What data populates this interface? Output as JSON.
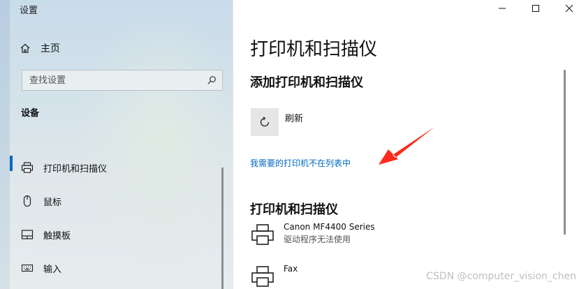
{
  "window": {
    "title": "设置",
    "controls": {
      "minimize": "—",
      "maximize": "☐",
      "close": "✕"
    }
  },
  "sidebar": {
    "home_label": "主页",
    "search": {
      "placeholder": "查找设置"
    },
    "section_heading": "设备",
    "items": [
      {
        "label": "打印机和扫描仪",
        "icon": "printer-icon",
        "active": true
      },
      {
        "label": "鼠标",
        "icon": "mouse-icon",
        "active": false
      },
      {
        "label": "触摸板",
        "icon": "touchpad-icon",
        "active": false
      },
      {
        "label": "输入",
        "icon": "keyboard-icon",
        "active": false
      }
    ]
  },
  "main": {
    "title": "打印机和扫描仪",
    "add_heading": "添加打印机和扫描仪",
    "refresh_label": "刷新",
    "missing_printer_link": "我需要的打印机不在列表中",
    "list_heading": "打印机和扫描仪",
    "printers": [
      {
        "name": "Canon MF4400 Series",
        "status": "驱动程序无法使用"
      },
      {
        "name": "Fax",
        "status": ""
      }
    ]
  },
  "annotation": {
    "arrow_color": "#ff2a1a"
  },
  "watermark": "CSDN @computer_vision_chen",
  "colors": {
    "accent": "#0067c0"
  }
}
